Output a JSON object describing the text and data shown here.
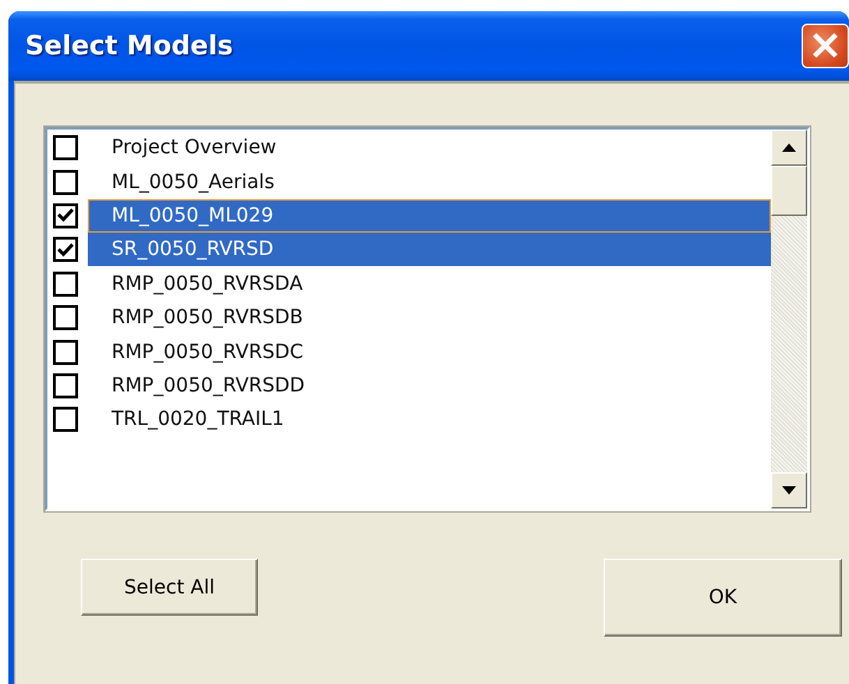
{
  "window": {
    "title": "Select Models",
    "close_label": "×"
  },
  "models": [
    {
      "label": "Project Overview",
      "checked": false,
      "selected": false,
      "focused": false
    },
    {
      "label": "ML_0050_Aerials",
      "checked": false,
      "selected": false,
      "focused": false
    },
    {
      "label": "ML_0050_ML029",
      "checked": true,
      "selected": true,
      "focused": true
    },
    {
      "label": "SR_0050_RVRSD",
      "checked": true,
      "selected": true,
      "focused": false
    },
    {
      "label": "RMP_0050_RVRSDA",
      "checked": false,
      "selected": false,
      "focused": false
    },
    {
      "label": "RMP_0050_RVRSDB",
      "checked": false,
      "selected": false,
      "focused": false
    },
    {
      "label": "RMP_0050_RVRSDC",
      "checked": false,
      "selected": false,
      "focused": false
    },
    {
      "label": "RMP_0050_RVRSDD",
      "checked": false,
      "selected": false,
      "focused": false
    },
    {
      "label": "TRL_0020_TRAIL1",
      "checked": false,
      "selected": false,
      "focused": false
    }
  ],
  "buttons": [
    {
      "label": "Select All",
      "kind": "secondary"
    },
    {
      "label": "OK",
      "kind": "default"
    }
  ]
}
